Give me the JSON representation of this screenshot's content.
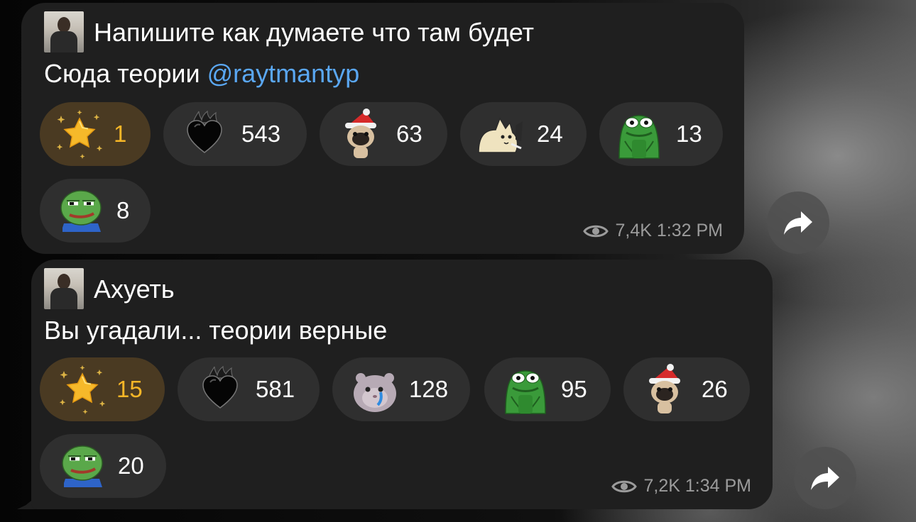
{
  "messages": [
    {
      "line1": "Напишите как думаете что там будет",
      "line2_prefix": "Сюда теории ",
      "mention": "@raytmantyp",
      "reactions": [
        {
          "emoji": "star-icon",
          "count": "1"
        },
        {
          "emoji": "black-heart-icon",
          "count": "543"
        },
        {
          "emoji": "pug-santa-hat-icon",
          "count": "63"
        },
        {
          "emoji": "cat-icon",
          "count": "24"
        },
        {
          "emoji": "pepe-frog-icon",
          "count": "13"
        },
        {
          "emoji": "pepe-smirk-icon",
          "count": "8"
        }
      ],
      "views": "7,4K",
      "time": "1:32 PM"
    },
    {
      "line1": "Ахуеть",
      "line2": "Вы угадали... теории верные",
      "reactions": [
        {
          "emoji": "star-icon",
          "count": "15"
        },
        {
          "emoji": "black-heart-icon",
          "count": "581"
        },
        {
          "emoji": "crying-hamster-icon",
          "count": "128"
        },
        {
          "emoji": "pepe-frog-icon",
          "count": "95"
        },
        {
          "emoji": "pug-santa-hat-icon",
          "count": "26"
        },
        {
          "emoji": "pepe-smirk-icon",
          "count": "20"
        }
      ],
      "views": "7,2K",
      "time": "1:34 PM"
    }
  ],
  "colors": {
    "bubble": "#1f1f1f",
    "chip": "#2f2f2f",
    "star_chip": "#4a3a22",
    "star_count": "#f7b627",
    "mention": "#5aa7f2",
    "meta": "#9b9b9b"
  }
}
